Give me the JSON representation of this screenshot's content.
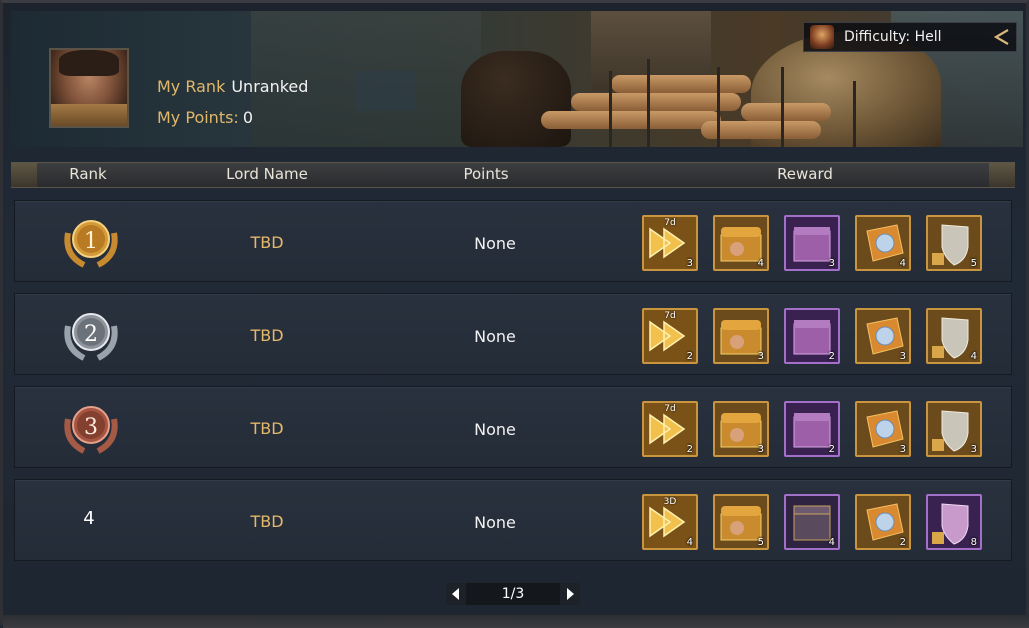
{
  "profile": {
    "my_rank_label": "My Rank",
    "my_rank_value": "Unranked",
    "my_points_label": "My Points:",
    "my_points_value": "0"
  },
  "difficulty": {
    "label": "Difficulty: Hell",
    "icon": "difficulty-demon-icon",
    "toggle_icon": "chevron-left-icon"
  },
  "table": {
    "headers": {
      "rank": "Rank",
      "lord_name": "Lord Name",
      "points": "Points",
      "reward": "Reward"
    },
    "rows": [
      {
        "rank": "1",
        "medal": "gold-medal-icon",
        "lord": "TBD",
        "points": "None",
        "rewards": [
          {
            "icon": "speedup-icon",
            "tag": "7d",
            "count": "3",
            "style": "gold"
          },
          {
            "icon": "treasure-chest-icon",
            "count": "4",
            "style": "gold"
          },
          {
            "icon": "purple-chest-icon",
            "count": "3",
            "style": "purple"
          },
          {
            "icon": "puzzle-gem-icon",
            "count": "4",
            "style": "gold"
          },
          {
            "icon": "shield-icon",
            "count": "5",
            "style": "gold"
          }
        ]
      },
      {
        "rank": "2",
        "medal": "silver-medal-icon",
        "lord": "TBD",
        "points": "None",
        "rewards": [
          {
            "icon": "speedup-icon",
            "tag": "7d",
            "count": "2",
            "style": "gold"
          },
          {
            "icon": "treasure-chest-icon",
            "count": "3",
            "style": "gold"
          },
          {
            "icon": "purple-chest-icon",
            "count": "2",
            "style": "purple"
          },
          {
            "icon": "puzzle-gem-icon",
            "count": "3",
            "style": "gold"
          },
          {
            "icon": "shield-icon",
            "count": "4",
            "style": "gold"
          }
        ]
      },
      {
        "rank": "3",
        "medal": "bronze-medal-icon",
        "lord": "TBD",
        "points": "None",
        "rewards": [
          {
            "icon": "speedup-icon",
            "tag": "7d",
            "count": "2",
            "style": "gold"
          },
          {
            "icon": "treasure-chest-icon",
            "count": "3",
            "style": "gold"
          },
          {
            "icon": "purple-chest-icon",
            "count": "2",
            "style": "purple"
          },
          {
            "icon": "puzzle-gem-icon",
            "count": "3",
            "style": "gold"
          },
          {
            "icon": "shield-icon",
            "count": "3",
            "style": "gold"
          }
        ]
      },
      {
        "rank": "4",
        "medal": "",
        "lord": "TBD",
        "points": "None",
        "rewards": [
          {
            "icon": "speedup-icon",
            "tag": "3D",
            "count": "4",
            "style": "gold"
          },
          {
            "icon": "treasure-chest-icon",
            "count": "5",
            "style": "gold"
          },
          {
            "icon": "gold-trimmed-chest-icon",
            "count": "4",
            "style": "purple"
          },
          {
            "icon": "puzzle-gem-icon",
            "count": "2",
            "style": "gold"
          },
          {
            "icon": "purple-shield-icon",
            "count": "8",
            "style": "purple"
          }
        ]
      }
    ]
  },
  "pagination": {
    "label": "1/3",
    "prev_icon": "arrow-left-icon",
    "next_icon": "arrow-right-icon"
  },
  "colors": {
    "accent_gold": "#e6b86a",
    "reward_gold_border": "#c9953e",
    "reward_purple_border": "#a270c8"
  }
}
